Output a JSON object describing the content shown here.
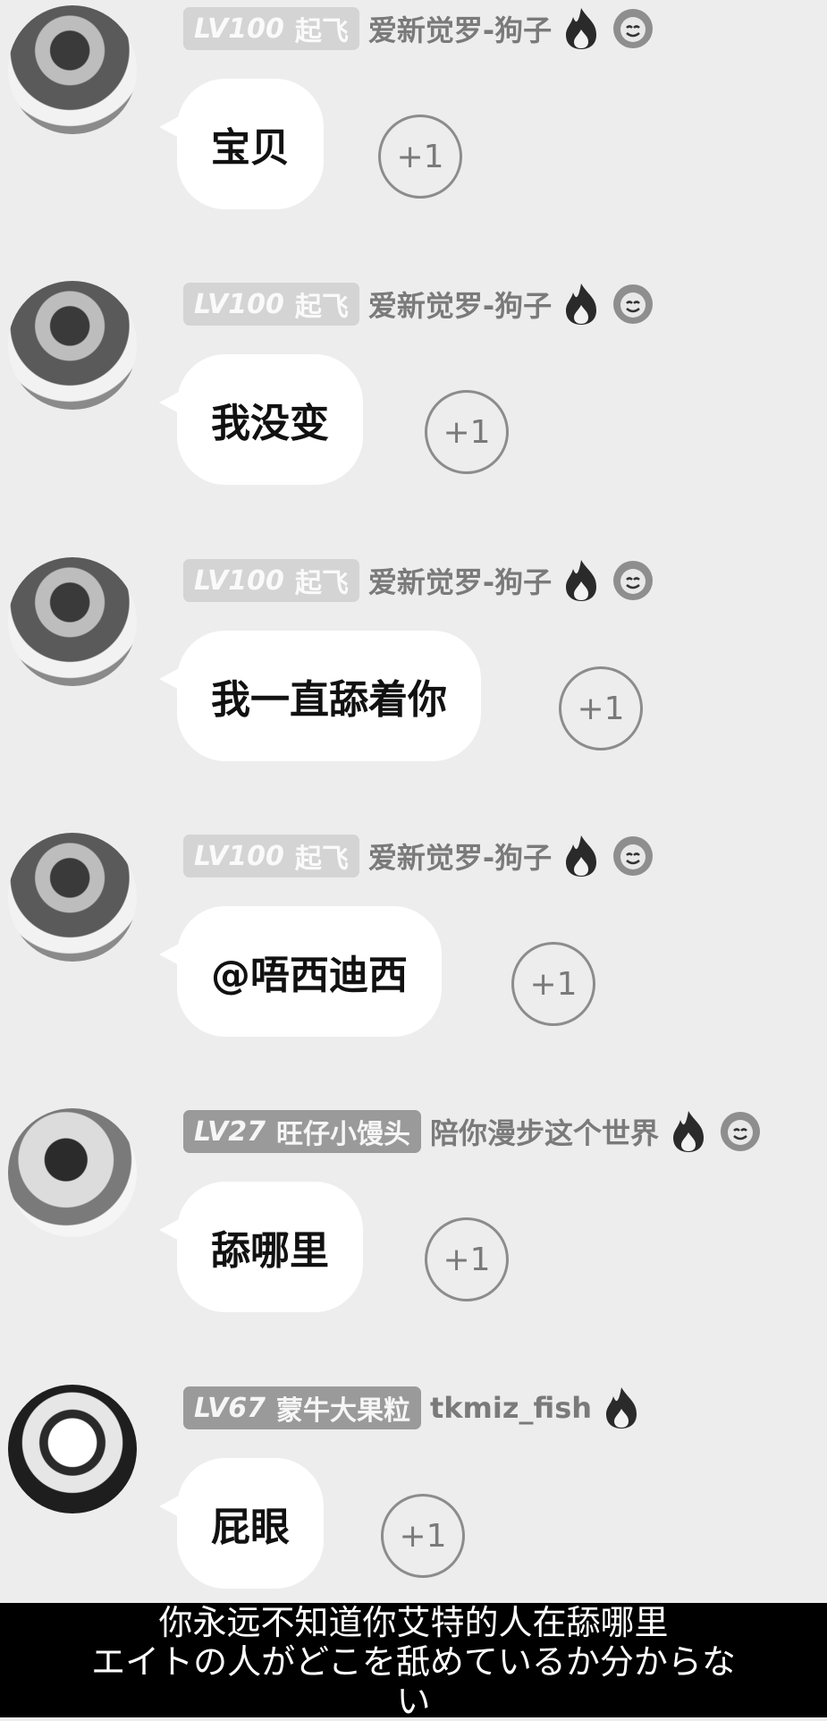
{
  "messages": [
    {
      "level": "LV100",
      "club": "起飞",
      "username": "爱新觉罗-狗子",
      "text": "宝贝",
      "reply": "+1",
      "icons": [
        "fire-icon",
        "flower-icon"
      ]
    },
    {
      "level": "LV100",
      "club": "起飞",
      "username": "爱新觉罗-狗子",
      "text": "我没变",
      "reply": "+1",
      "icons": [
        "fire-icon",
        "flower-icon"
      ]
    },
    {
      "level": "LV100",
      "club": "起飞",
      "username": "爱新觉罗-狗子",
      "text": "我一直舔着你",
      "reply": "+1",
      "icons": [
        "fire-icon",
        "flower-icon"
      ]
    },
    {
      "level": "LV100",
      "club": "起飞",
      "username": "爱新觉罗-狗子",
      "text": "@唔西迪西",
      "reply": "+1",
      "icons": [
        "fire-icon",
        "flower-icon"
      ]
    },
    {
      "level": "LV27",
      "club": "旺仔小馒头",
      "username": "陪你漫步这个世界",
      "text": "舔哪里",
      "reply": "+1",
      "icons": [
        "fire-icon",
        "flower-icon"
      ]
    },
    {
      "level": "LV67",
      "club": "蒙牛大果粒",
      "username": "tkmiz_fish",
      "text": "屁眼",
      "reply": "+1",
      "icons": [
        "fire-icon"
      ]
    }
  ],
  "subtitle": {
    "line1": "你永远不知道你艾特的人在舔哪里",
    "line2": "エイトの人がどこを舐めているか分からな",
    "line3": "い"
  },
  "colors": {
    "background": "#ededed",
    "bubble": "#ffffff",
    "badge_light": "#d4d4d4",
    "badge_dark": "#9a9a9a",
    "subtitle_bg": "#000000"
  }
}
